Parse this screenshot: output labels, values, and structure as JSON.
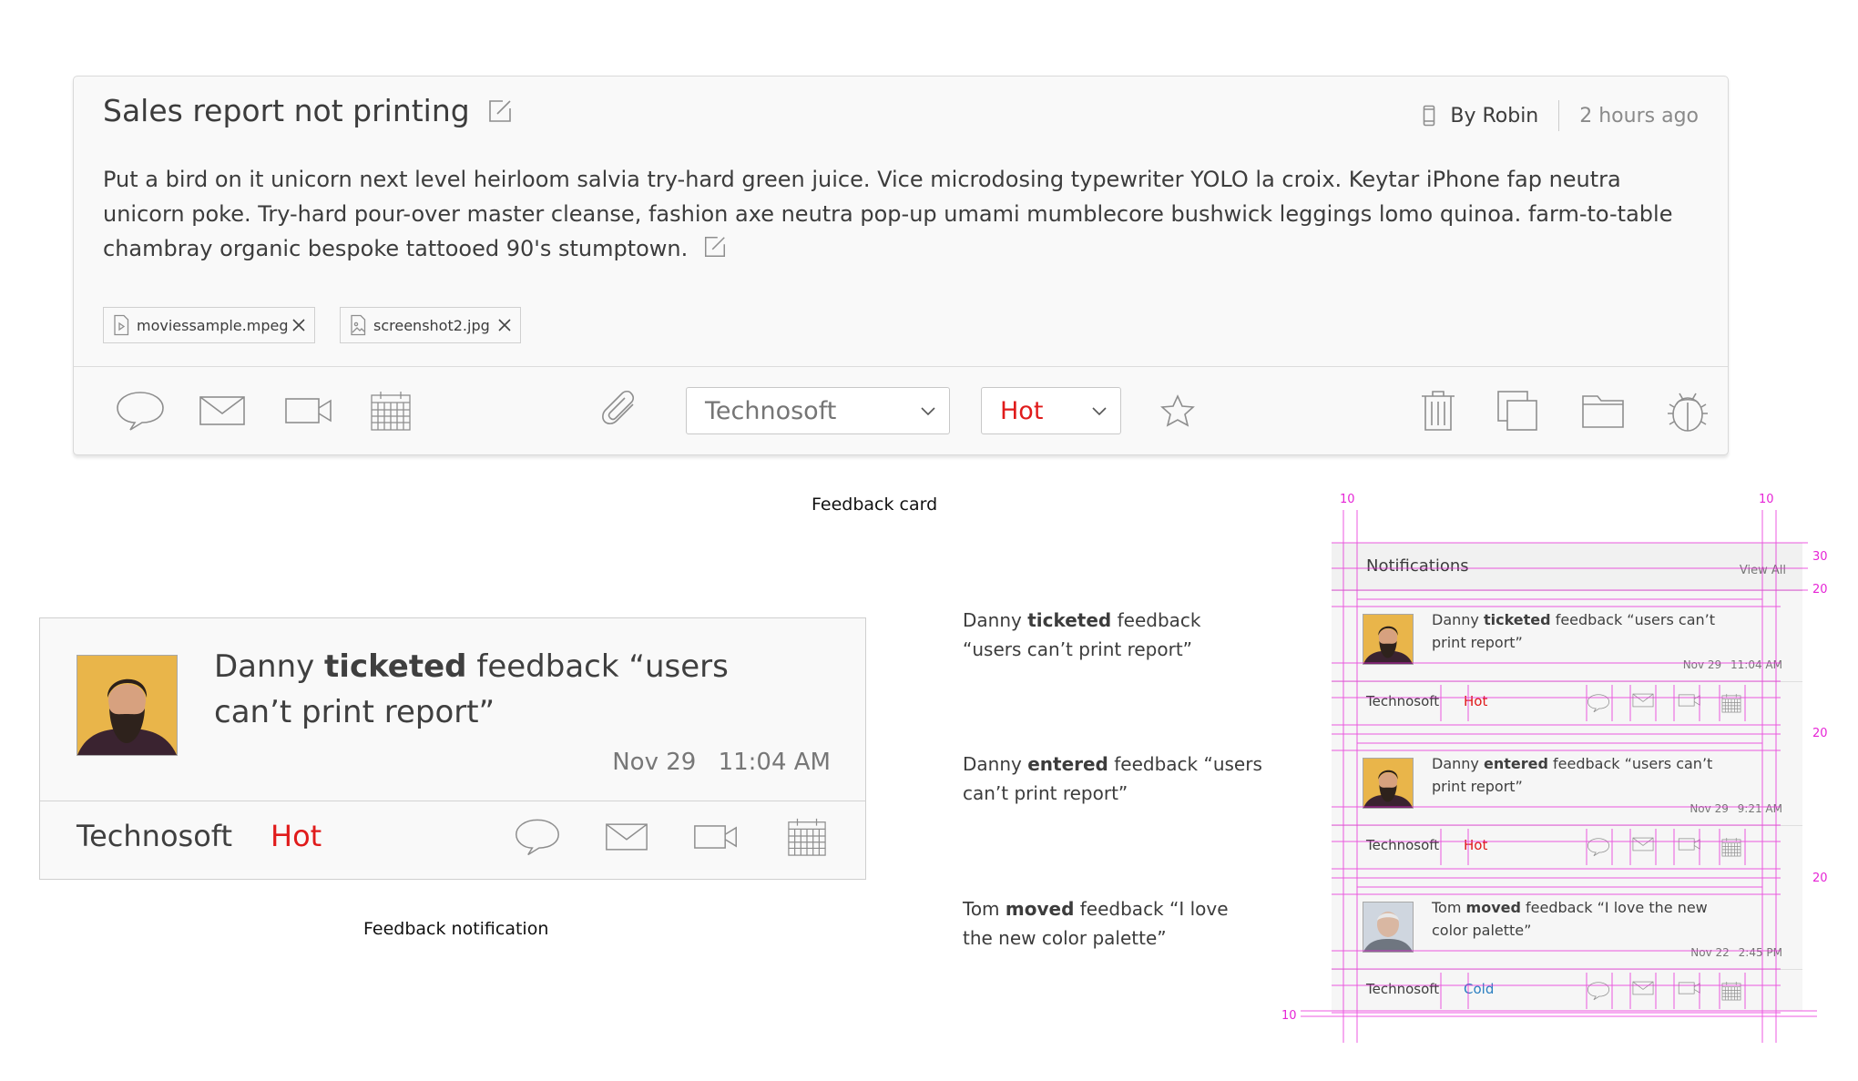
{
  "card": {
    "title": "Sales report not printing",
    "author": "By Robin",
    "time": "2 hours ago",
    "body": "Put a bird on it unicorn next level heirloom salvia try-hard green juice. Vice microdosing typewriter YOLO la croix. Keytar iPhone fap neutra unicorn poke. Try-hard pour-over master cleanse, fashion axe neutra pop-up umami mumblecore bushwick leggings lomo quinoa. farm-to-table chambray organic bespoke tattooed 90's stumptown.",
    "attachments": [
      {
        "name": "moviessample.mpeg",
        "icon": "video-file-icon"
      },
      {
        "name": "screenshot2.jpg",
        "icon": "image-file-icon"
      }
    ],
    "company_select": "Technosoft",
    "status_select": "Hot",
    "status_color": "#e01b1b"
  },
  "captions": {
    "card": "Feedback card",
    "notification": "Feedback notification"
  },
  "notification": {
    "actor": "Danny",
    "action": "ticketed",
    "text": "feedback “users can’t print report”",
    "date": "Nov 29",
    "clock": "11:04 AM",
    "company": "Technosoft",
    "status": "Hot"
  },
  "descriptions": [
    {
      "actor": "Danny",
      "action": "ticketed",
      "text": "feedback “users can’t print report”"
    },
    {
      "actor": "Danny",
      "action": "entered",
      "text": "feedback “users can’t print report”"
    },
    {
      "actor": "Tom",
      "action": "moved",
      "text": "feedback “I love the new color palette”"
    }
  ],
  "panel": {
    "title": "Notifications",
    "view_all": "View All",
    "items": [
      {
        "actor": "Danny",
        "action": "ticketed",
        "text": "feedback “users can’t print report”",
        "date": "Nov 29",
        "clock": "11:04 AM",
        "company": "Technosoft",
        "status": "Hot",
        "status_color": "#e01b1b"
      },
      {
        "actor": "Danny",
        "action": "entered",
        "text": "feedback “users can’t print report”",
        "date": "Nov 29",
        "clock": "9:21 AM",
        "company": "Technosoft",
        "status": "Hot",
        "status_color": "#e01b1b"
      },
      {
        "actor": "Tom",
        "action": "moved",
        "text": "feedback “I love the new color palette”",
        "date": "Nov 22",
        "clock": "2:45 PM",
        "company": "Technosoft",
        "status": "Cold",
        "status_color": "#2a7fc1"
      }
    ],
    "spec": {
      "top_left": "10",
      "top_right": "10",
      "header_height": "30",
      "header_gap": "20",
      "row_gap_1": "20",
      "row_gap_2": "20",
      "bottom_left": "10",
      "guide_color": "#e624d6"
    }
  }
}
